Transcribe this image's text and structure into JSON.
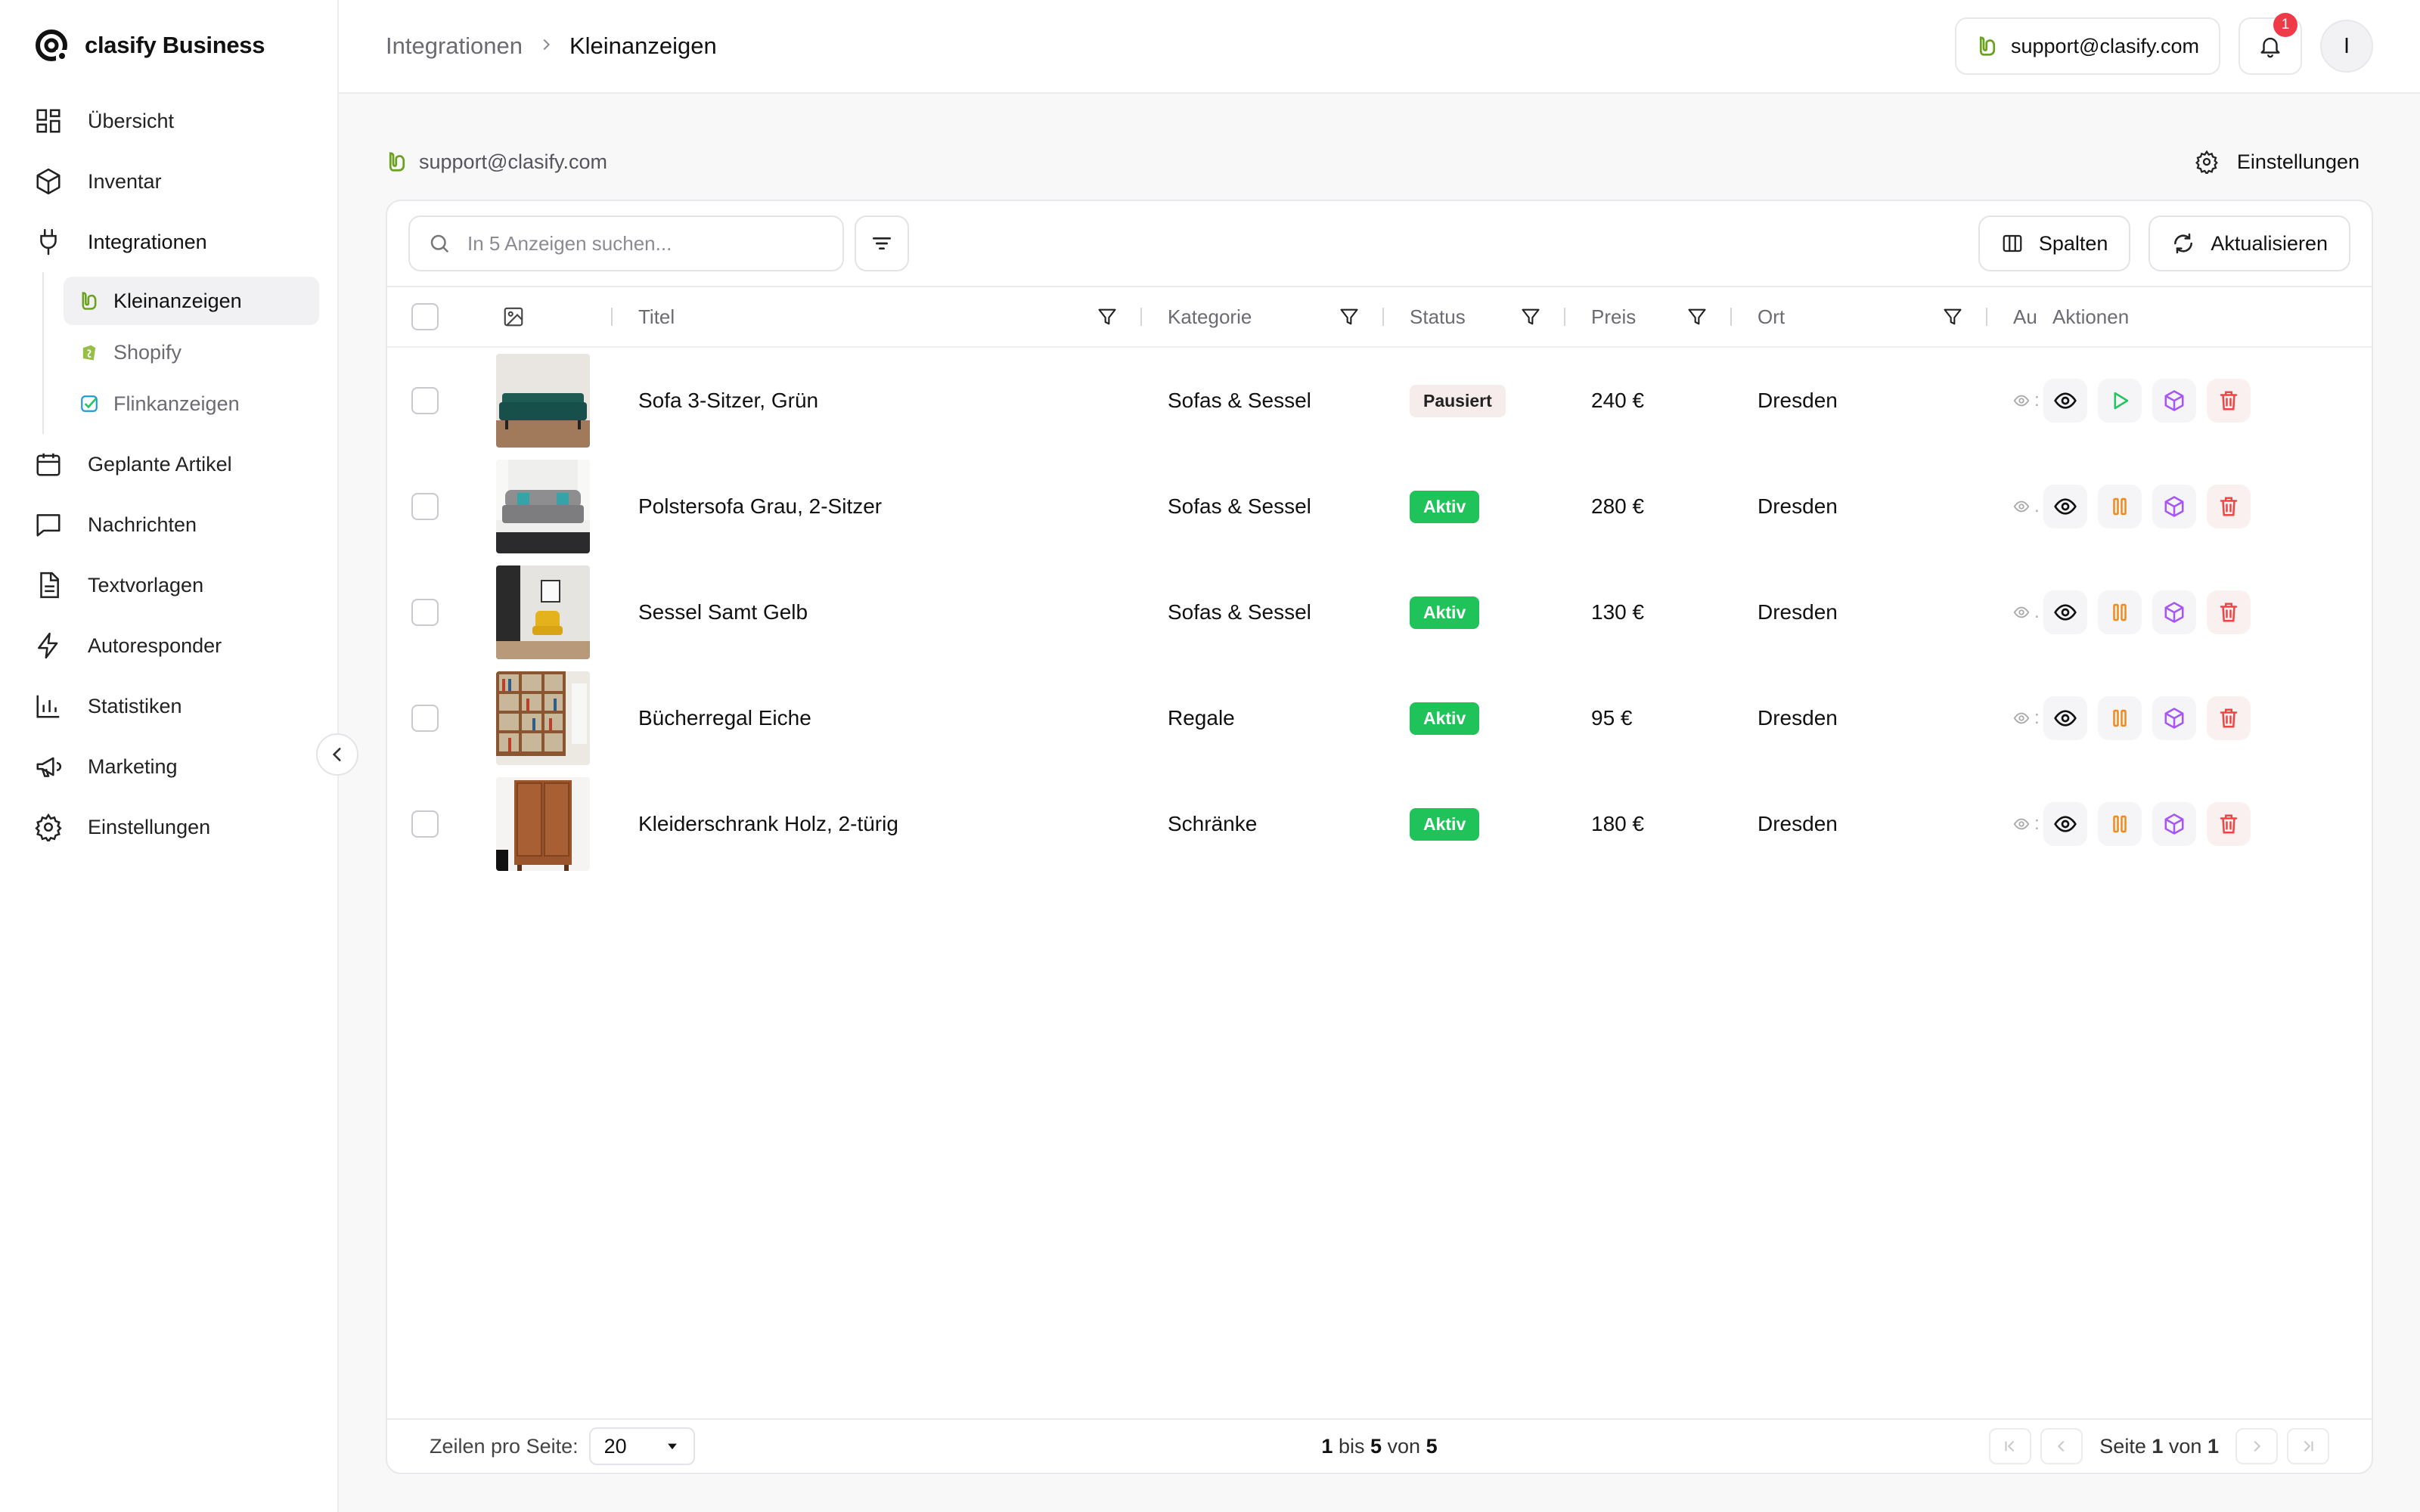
{
  "brand": {
    "name": "clasify Business"
  },
  "sidebar": {
    "items": [
      {
        "label": "Übersicht",
        "icon": "dashboard-icon"
      },
      {
        "label": "Inventar",
        "icon": "box-icon"
      },
      {
        "label": "Integrationen",
        "icon": "plug-icon"
      },
      {
        "label": "Geplante Artikel",
        "icon": "calendar-icon"
      },
      {
        "label": "Nachrichten",
        "icon": "chat-icon"
      },
      {
        "label": "Textvorlagen",
        "icon": "document-icon"
      },
      {
        "label": "Autoresponder",
        "icon": "bolt-icon"
      },
      {
        "label": "Statistiken",
        "icon": "bar-chart-icon"
      },
      {
        "label": "Marketing",
        "icon": "megaphone-icon"
      },
      {
        "label": "Einstellungen",
        "icon": "gear-icon"
      }
    ],
    "subitems": [
      {
        "label": "Kleinanzeigen",
        "icon": "kleinanzeigen-icon"
      },
      {
        "label": "Shopify",
        "icon": "shopify-icon"
      },
      {
        "label": "Flinkanzeigen",
        "icon": "flinkanzeigen-icon"
      }
    ]
  },
  "breadcrumb": {
    "parent": "Integrationen",
    "current": "Kleinanzeigen"
  },
  "header": {
    "account": "support@clasify.com",
    "notifications": "1",
    "avatar": "I"
  },
  "content": {
    "account": "support@clasify.com",
    "settings": "Einstellungen"
  },
  "toolbar": {
    "search_placeholder": "In 5 Anzeigen suchen...",
    "columns_label": "Spalten",
    "refresh_label": "Aktualisieren"
  },
  "table": {
    "columns": {
      "title": "Titel",
      "category": "Kategorie",
      "status": "Status",
      "price": "Preis",
      "location": "Ort",
      "au": "Au",
      "actions": "Aktionen"
    },
    "rows": [
      {
        "title": "Sofa 3-Sitzer, Grün",
        "category": "Sofas & Sessel",
        "status": "Pausiert",
        "status_type": "paused",
        "price": "240 €",
        "location": "Dresden",
        "au": ":"
      },
      {
        "title": "Polstersofa Grau, 2-Sitzer",
        "category": "Sofas & Sessel",
        "status": "Aktiv",
        "status_type": "active",
        "price": "280 €",
        "location": "Dresden",
        "au": "."
      },
      {
        "title": "Sessel Samt Gelb",
        "category": "Sofas & Sessel",
        "status": "Aktiv",
        "status_type": "active",
        "price": "130 €",
        "location": "Dresden",
        "au": "."
      },
      {
        "title": "Bücherregal Eiche",
        "category": "Regale",
        "status": "Aktiv",
        "status_type": "active",
        "price": "95 €",
        "location": "Dresden",
        "au": ":"
      },
      {
        "title": "Kleiderschrank Holz, 2-türig",
        "category": "Schränke",
        "status": "Aktiv",
        "status_type": "active",
        "price": "180 €",
        "location": "Dresden",
        "au": ":"
      }
    ]
  },
  "footer": {
    "rows_label": "Zeilen pro Seite:",
    "rows_value": "20",
    "range_from": "1",
    "range_mid": "bis",
    "range_to": "5",
    "range_of": "von",
    "range_total": "5",
    "page_label": "Seite",
    "page_current": "1",
    "page_of": "von",
    "page_total": "1"
  },
  "colors": {
    "active_green": "#1fc35a",
    "pause_orange": "#f08a1c",
    "play_green": "#22c55e",
    "purple": "#a855f7",
    "delete_red": "#ef4444"
  }
}
